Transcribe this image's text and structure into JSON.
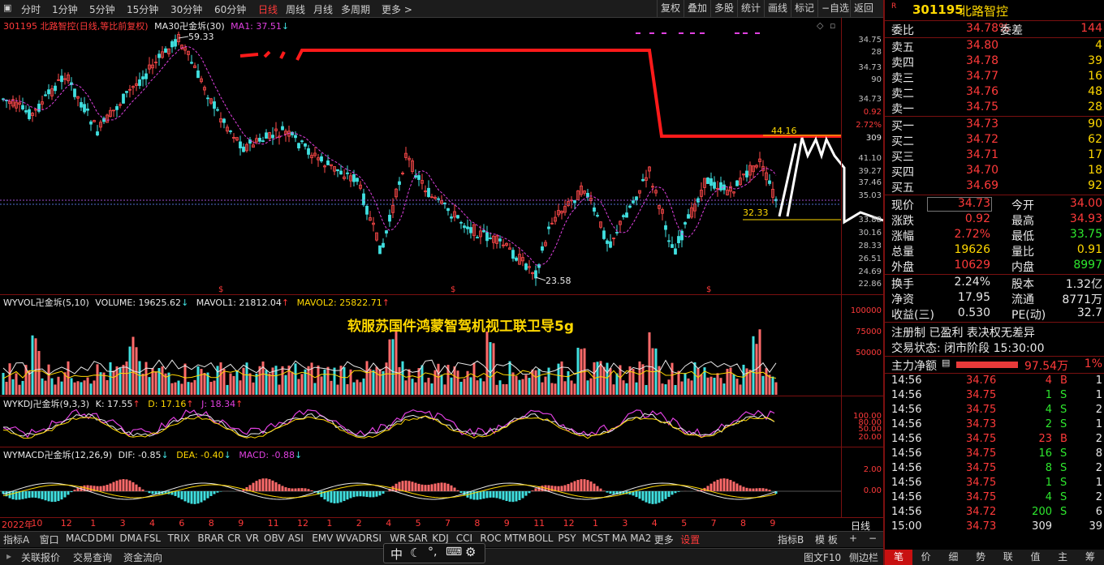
{
  "toolbar": {
    "periods": [
      "分时",
      "1分钟",
      "5分钟",
      "15分钟",
      "30分钟",
      "60分钟",
      "日线",
      "周线",
      "月线",
      "多周期",
      "更多 >"
    ],
    "active_period": "日线",
    "actions": [
      "复权",
      "叠加",
      "多股",
      "统计",
      "画线",
      "标记",
      "−自选",
      "返回"
    ]
  },
  "chart": {
    "stock_title": "301195 北路智控(日线,等比前复权)",
    "ma_label": "MA30卍金坼(30)",
    "ma1_label": "MA1: 37.51",
    "high_marker": "59.33",
    "low_marker": "23.58",
    "level_44": "44.16",
    "level_32": "32.33",
    "price_axis": [
      "34.75",
      "28",
      "34.73",
      "90",
      "34.73",
      "0.92",
      "2.72%",
      "309",
      "41.10",
      "39.27",
      "37.46",
      "35.03",
      "33.88",
      "30.16",
      "28.33",
      "26.51",
      "24.69",
      "22.86"
    ],
    "vol_title": "WYVOL卍金坼(5,10)",
    "vol_value": "VOLUME: 19625.62",
    "mavol1": "MAVOL1: 21812.04",
    "mavol2": "MAVOL2: 25822.71",
    "vol_axis": [
      "100000",
      "75000",
      "50000"
    ],
    "watermark": "软服苏国件鸿蒙智驾机视工联卫导5g",
    "kdj_title": "WYKDJ卍金坼(9,3,3)",
    "kdj_k": "K: 17.55",
    "kdj_d": "D: 17.16",
    "kdj_j": "J: 18.34",
    "kdj_axis": [
      "100.00",
      "80.00",
      "50.00",
      "20.00"
    ],
    "macd_title": "WYMACD卍金坼(12,26,9)",
    "macd_dif": "DIF: -0.85",
    "macd_dea": "DEA: -0.40",
    "macd_macd": "MACD: -0.88",
    "macd_axis": [
      "2.00",
      "0.00"
    ],
    "date_axis": [
      "2022年",
      "10",
      "12",
      "1",
      "3",
      "4",
      "6",
      "8",
      "9",
      "11",
      "12",
      "1",
      "2",
      "4",
      "5",
      "7",
      "8",
      "9",
      "11",
      "12",
      "1",
      "3",
      "4",
      "5",
      "7",
      "8",
      "9"
    ],
    "axis_bottom_label": "日线"
  },
  "indicator_tabs": [
    "指标A",
    "窗口",
    "MACD",
    "DMI",
    "DMA",
    "FSL",
    "TRIX",
    "BRAR",
    "CR",
    "VR",
    "OBV",
    "ASI",
    "EMV",
    "WVAD",
    "RSI",
    "WR",
    "SAR",
    "KDJ",
    "CCI",
    "ROC",
    "MTM",
    "BOLL",
    "PSY",
    "MCST",
    "MA",
    "MA2",
    "更多",
    "设置"
  ],
  "indicator_right": [
    "指标B",
    "模 板",
    "+",
    "−"
  ],
  "status_items": [
    "关联报价",
    "交易查询",
    "资金流向"
  ],
  "status_right": [
    "图文F10",
    "侧边栏"
  ],
  "quote": {
    "code": "301195",
    "name": "北路智控",
    "weibi_label": "委比",
    "weibi": "34.78%",
    "weicha_label": "委差",
    "weicha": "144",
    "asks": [
      {
        "label": "卖五",
        "price": "34.80",
        "vol": "4"
      },
      {
        "label": "卖四",
        "price": "34.78",
        "vol": "39"
      },
      {
        "label": "卖三",
        "price": "34.77",
        "vol": "16"
      },
      {
        "label": "卖二",
        "price": "34.76",
        "vol": "48"
      },
      {
        "label": "卖一",
        "price": "34.75",
        "vol": "28"
      }
    ],
    "bids": [
      {
        "label": "买一",
        "price": "34.73",
        "vol": "90"
      },
      {
        "label": "买二",
        "price": "34.72",
        "vol": "62"
      },
      {
        "label": "买三",
        "price": "34.71",
        "vol": "17"
      },
      {
        "label": "买四",
        "price": "34.70",
        "vol": "18"
      },
      {
        "label": "买五",
        "price": "34.69",
        "vol": "92"
      }
    ],
    "stats": [
      {
        "l1": "现价",
        "v1": "34.73",
        "c1": "red",
        "l2": "今开",
        "v2": "34.00",
        "c2": "red"
      },
      {
        "l1": "涨跌",
        "v1": "0.92",
        "c1": "red",
        "l2": "最高",
        "v2": "34.93",
        "c2": "red"
      },
      {
        "l1": "涨幅",
        "v1": "2.72%",
        "c1": "red",
        "l2": "最低",
        "v2": "33.75",
        "c2": "green"
      },
      {
        "l1": "总量",
        "v1": "19626",
        "c1": "yellow",
        "l2": "量比",
        "v2": "0.91",
        "c2": "yellow"
      },
      {
        "l1": "外盘",
        "v1": "10629",
        "c1": "red",
        "l2": "内盘",
        "v2": "8997",
        "c2": "green"
      }
    ],
    "stats2": [
      {
        "l1": "换手",
        "v1": "2.24%",
        "l2": "股本",
        "v2": "1.32亿"
      },
      {
        "l1": "净资",
        "v1": "17.95",
        "l2": "流通",
        "v2": "8771万"
      },
      {
        "l1": "收益(三)",
        "v1": "0.530",
        "l2": "PE(动)",
        "v2": "32.7"
      }
    ],
    "reg_line": "注册制 已盈利 表决权无差异",
    "trade_status": "交易状态: 闭市阶段 15:30:00",
    "main_flow_label": "主力净额",
    "main_flow_value": "97.54万",
    "main_flow_pct": "1%",
    "ticks": [
      {
        "t": "14:56",
        "p": "34.76",
        "v": "4",
        "bs": "B",
        "n": "1"
      },
      {
        "t": "14:56",
        "p": "34.75",
        "v": "1",
        "bs": "S",
        "n": "1"
      },
      {
        "t": "14:56",
        "p": "34.75",
        "v": "4",
        "bs": "S",
        "n": "2"
      },
      {
        "t": "14:56",
        "p": "34.73",
        "v": "2",
        "bs": "S",
        "n": "1"
      },
      {
        "t": "14:56",
        "p": "34.75",
        "v": "23",
        "bs": "B",
        "n": "2"
      },
      {
        "t": "14:56",
        "p": "34.75",
        "v": "16",
        "bs": "S",
        "n": "8"
      },
      {
        "t": "14:56",
        "p": "34.75",
        "v": "8",
        "bs": "S",
        "n": "2"
      },
      {
        "t": "14:56",
        "p": "34.75",
        "v": "1",
        "bs": "S",
        "n": "1"
      },
      {
        "t": "14:56",
        "p": "34.75",
        "v": "4",
        "bs": "S",
        "n": "2"
      },
      {
        "t": "14:56",
        "p": "34.72",
        "v": "200",
        "bs": "S",
        "n": "6"
      },
      {
        "t": "15:00",
        "p": "34.73",
        "v": "309",
        "bs": "",
        "n": "39"
      }
    ],
    "bottom_tabs": [
      "笔",
      "价",
      "细",
      "势",
      "联",
      "值",
      "主",
      "筹"
    ]
  }
}
